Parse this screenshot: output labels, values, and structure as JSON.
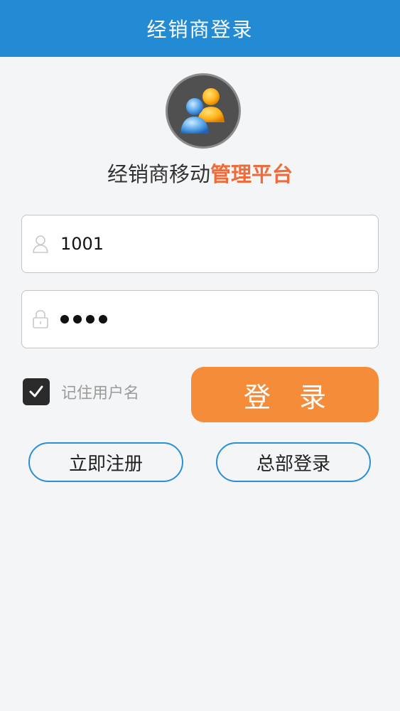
{
  "header": {
    "title": "经销商登录"
  },
  "brand": {
    "avatar_icon": "users-icon",
    "subtitle_part1": "经销商移动",
    "subtitle_part2": "管理平台"
  },
  "form": {
    "username": {
      "icon": "user-icon",
      "value": "1001"
    },
    "password": {
      "icon": "lock-icon",
      "masked_value": "●●●●"
    },
    "remember": {
      "label": "记住用户名",
      "checked": true
    },
    "login_label": "登录"
  },
  "actions": {
    "register_label": "立即注册",
    "hq_login_label": "总部登录"
  },
  "colors": {
    "header": "#238bd4",
    "accent_orange": "#f48c3a",
    "highlight_red": "#ef6b3c",
    "outline_blue": "#2a8fd4"
  }
}
